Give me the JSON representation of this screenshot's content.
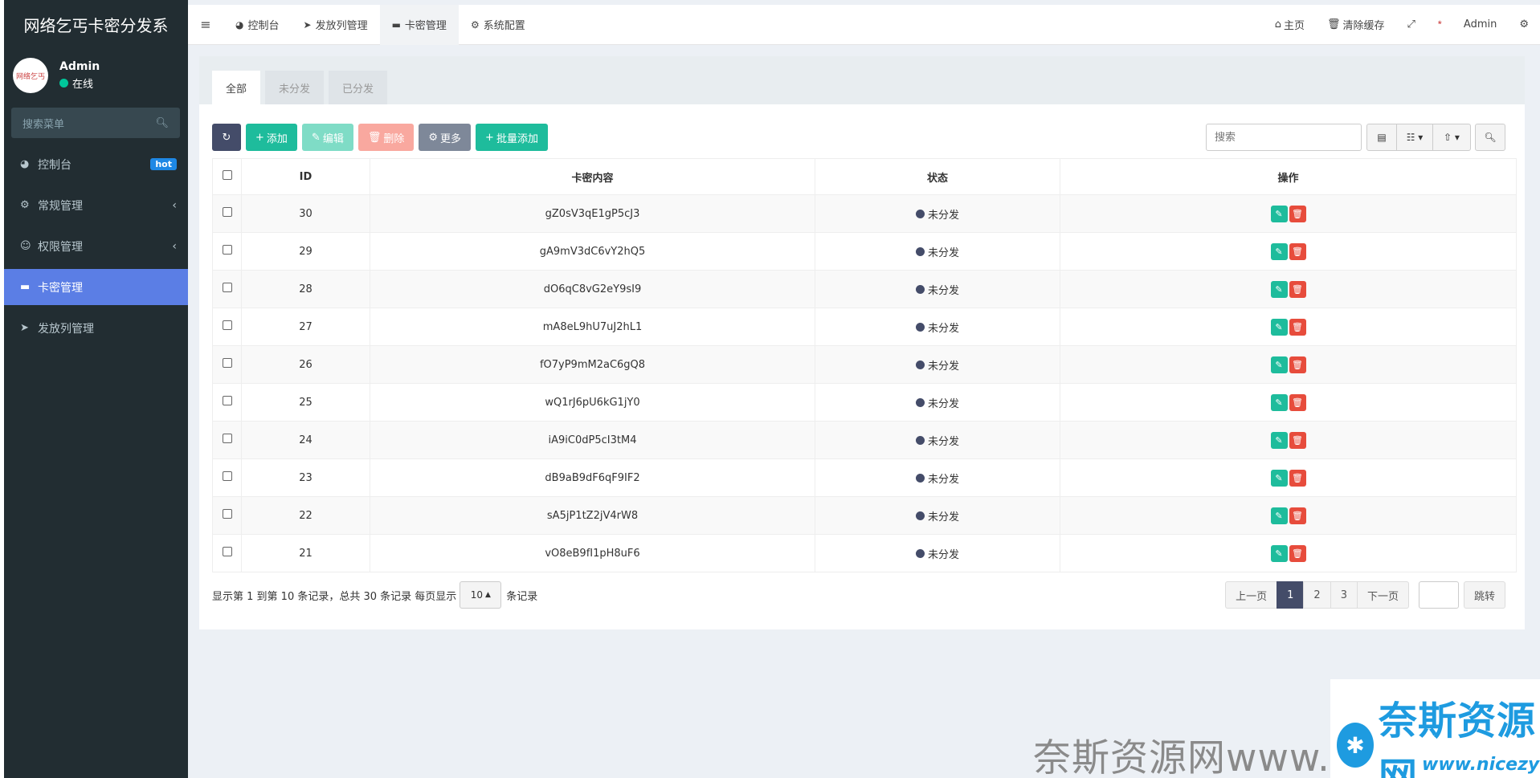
{
  "app": {
    "title": "网络乞丐卡密分发系",
    "avatar_text": "网络乞丐",
    "user_name": "Admin",
    "user_status": "在线"
  },
  "sidebar": {
    "search_placeholder": "搜索菜单",
    "items": [
      {
        "label": "控制台",
        "icon": "dashboard-icon",
        "badge": "hot"
      },
      {
        "label": "常规管理",
        "icon": "cogs-icon"
      },
      {
        "label": "权限管理",
        "icon": "users-icon"
      },
      {
        "label": "卡密管理",
        "icon": "card-icon",
        "active": true
      },
      {
        "label": "发放列管理",
        "icon": "paper-plane-icon"
      }
    ]
  },
  "navbar": {
    "tabs": [
      {
        "label": "控制台",
        "icon": "dashboard-icon"
      },
      {
        "label": "发放列管理",
        "icon": "paper-plane-icon"
      },
      {
        "label": "卡密管理",
        "icon": "card-icon",
        "active": true
      },
      {
        "label": "系统配置",
        "icon": "gear-icon"
      }
    ],
    "home_label": "主页",
    "clear_cache_label": "清除缓存",
    "user_label": "Admin"
  },
  "filter_tabs": [
    "全部",
    "未分发",
    "已分发"
  ],
  "toolbar": {
    "add_label": "添加",
    "edit_label": "编辑",
    "delete_label": "删除",
    "more_label": "更多",
    "batch_add_label": "批量添加",
    "search_placeholder": "搜索"
  },
  "table": {
    "columns": [
      "ID",
      "卡密内容",
      "状态",
      "操作"
    ],
    "rows": [
      {
        "id": "30",
        "content": "gZ0sV3qE1gP5cJ3",
        "status": "未分发"
      },
      {
        "id": "29",
        "content": "gA9mV3dC6vY2hQ5",
        "status": "未分发"
      },
      {
        "id": "28",
        "content": "dO6qC8vG2eY9sI9",
        "status": "未分发"
      },
      {
        "id": "27",
        "content": "mA8eL9hU7uJ2hL1",
        "status": "未分发"
      },
      {
        "id": "26",
        "content": "fO7yP9mM2aC6gQ8",
        "status": "未分发"
      },
      {
        "id": "25",
        "content": "wQ1rJ6pU6kG1jY0",
        "status": "未分发"
      },
      {
        "id": "24",
        "content": "iA9iC0dP5cI3tM4",
        "status": "未分发"
      },
      {
        "id": "23",
        "content": "dB9aB9dF6qF9IF2",
        "status": "未分发"
      },
      {
        "id": "22",
        "content": "sA5jP1tZ2jV4rW8",
        "status": "未分发"
      },
      {
        "id": "21",
        "content": "vO8eB9fI1pH8uF6",
        "status": "未分发"
      }
    ]
  },
  "pagination": {
    "summary": "显示第 1 到第 10 条记录，总共 30 条记录 每页显示",
    "page_size": "10",
    "suffix": "条记录",
    "prev_label": "上一页",
    "pages": [
      "1",
      "2",
      "3"
    ],
    "current_page": "1",
    "next_label": "下一页",
    "jump_label": "跳转"
  },
  "watermark": {
    "brand": "奈斯资源网",
    "line": "奈斯资源网www.nicezyw.com",
    "url": "www.nicezyw.com"
  },
  "colors": {
    "sidebar_bg": "#222d32",
    "active_menu": "#5b7ee5",
    "primary_dark": "#444c69",
    "success": "#1ebc9c",
    "danger": "#e74c3c"
  }
}
